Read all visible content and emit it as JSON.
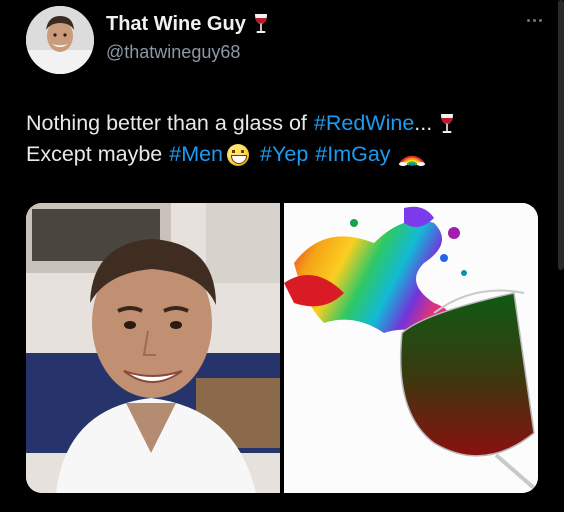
{
  "author": {
    "display_name": "That Wine Guy",
    "handle": "@thatwineguy68"
  },
  "tweet": {
    "line1_text": "Nothing better than a glass of",
    "line1_hashtag": "#RedWine",
    "line1_ellipsis": "...",
    "line2_text": "Except maybe",
    "line2_hashtags": [
      "#Men",
      "#Yep",
      "#ImGay"
    ]
  },
  "icons": {
    "wine": "wine-glass-icon",
    "grin": "grinning-face-icon",
    "rainbow": "rainbow-icon",
    "more": "more-options-icon"
  },
  "colors": {
    "background": "#000000",
    "text": "#e7e9ea",
    "hashtag": "#1d9bf0",
    "handle": "#8b98a5"
  }
}
